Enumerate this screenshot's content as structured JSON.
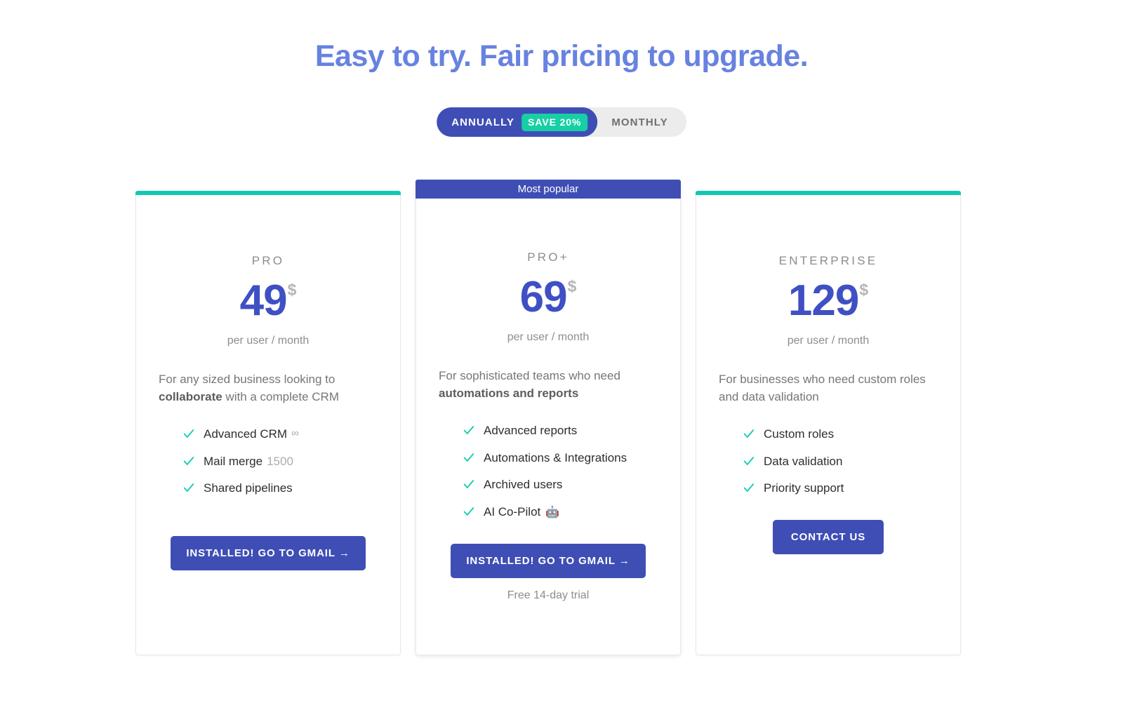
{
  "page": {
    "title": "Easy to try. Fair pricing to upgrade."
  },
  "billing_toggle": {
    "annual_label": "ANNUALLY",
    "save_badge": "SAVE 20%",
    "monthly_label": "MONTHLY",
    "selected": "ANNUALLY",
    "active_color": "#3f4eb5",
    "badge_color": "#17cfa5",
    "inactive_color": "#ececec"
  },
  "plans": [
    {
      "ribbon": "",
      "accent_color": "#10c9b2",
      "name": "PRO",
      "price": "49",
      "currency": "$",
      "period": "per user / month",
      "tagline_pre": "For any sized business looking to ",
      "tagline_bold": "collaborate",
      "tagline_post": " with a complete CRM",
      "features": [
        {
          "label": "Advanced CRM",
          "sub": "∞"
        },
        {
          "label": "Mail merge",
          "sub": "1500"
        },
        {
          "label": "Shared pipelines",
          "sub": ""
        }
      ],
      "cta": "INSTALLED! GO TO GMAIL →",
      "note": ""
    },
    {
      "ribbon": "Most popular",
      "accent_color": "#3f4eb5",
      "name": "PRO+",
      "price": "69",
      "currency": "$",
      "period": "per user / month",
      "tagline_pre": "For sophisticated teams who need ",
      "tagline_bold": "automations and reports",
      "tagline_post": "",
      "features": [
        {
          "label": "Advanced reports",
          "sub": ""
        },
        {
          "label": "Automations & Integrations",
          "sub": ""
        },
        {
          "label": "Archived users",
          "sub": ""
        },
        {
          "label": "AI Co-Pilot",
          "sub": "",
          "emoji": "🤖"
        }
      ],
      "cta": "INSTALLED! GO TO GMAIL →",
      "note": "Free 14-day trial"
    },
    {
      "ribbon": "",
      "accent_color": "#10c9b2",
      "name": "ENTERPRISE",
      "price": "129",
      "currency": "$",
      "period": "per user / month",
      "tagline_pre": "For businesses who need custom roles and data validation",
      "tagline_bold": "",
      "tagline_post": "",
      "features": [
        {
          "label": "Custom roles",
          "sub": ""
        },
        {
          "label": "Data validation",
          "sub": ""
        },
        {
          "label": "Priority support",
          "sub": ""
        }
      ],
      "cta": "CONTACT US",
      "note": ""
    }
  ],
  "icons": {
    "check": "check-icon",
    "arrow": "arrow-right-icon"
  },
  "colors": {
    "heading": "#6782e0",
    "price": "#3f50c4",
    "check": "#14cfae",
    "muted": "#8d8d8d"
  }
}
